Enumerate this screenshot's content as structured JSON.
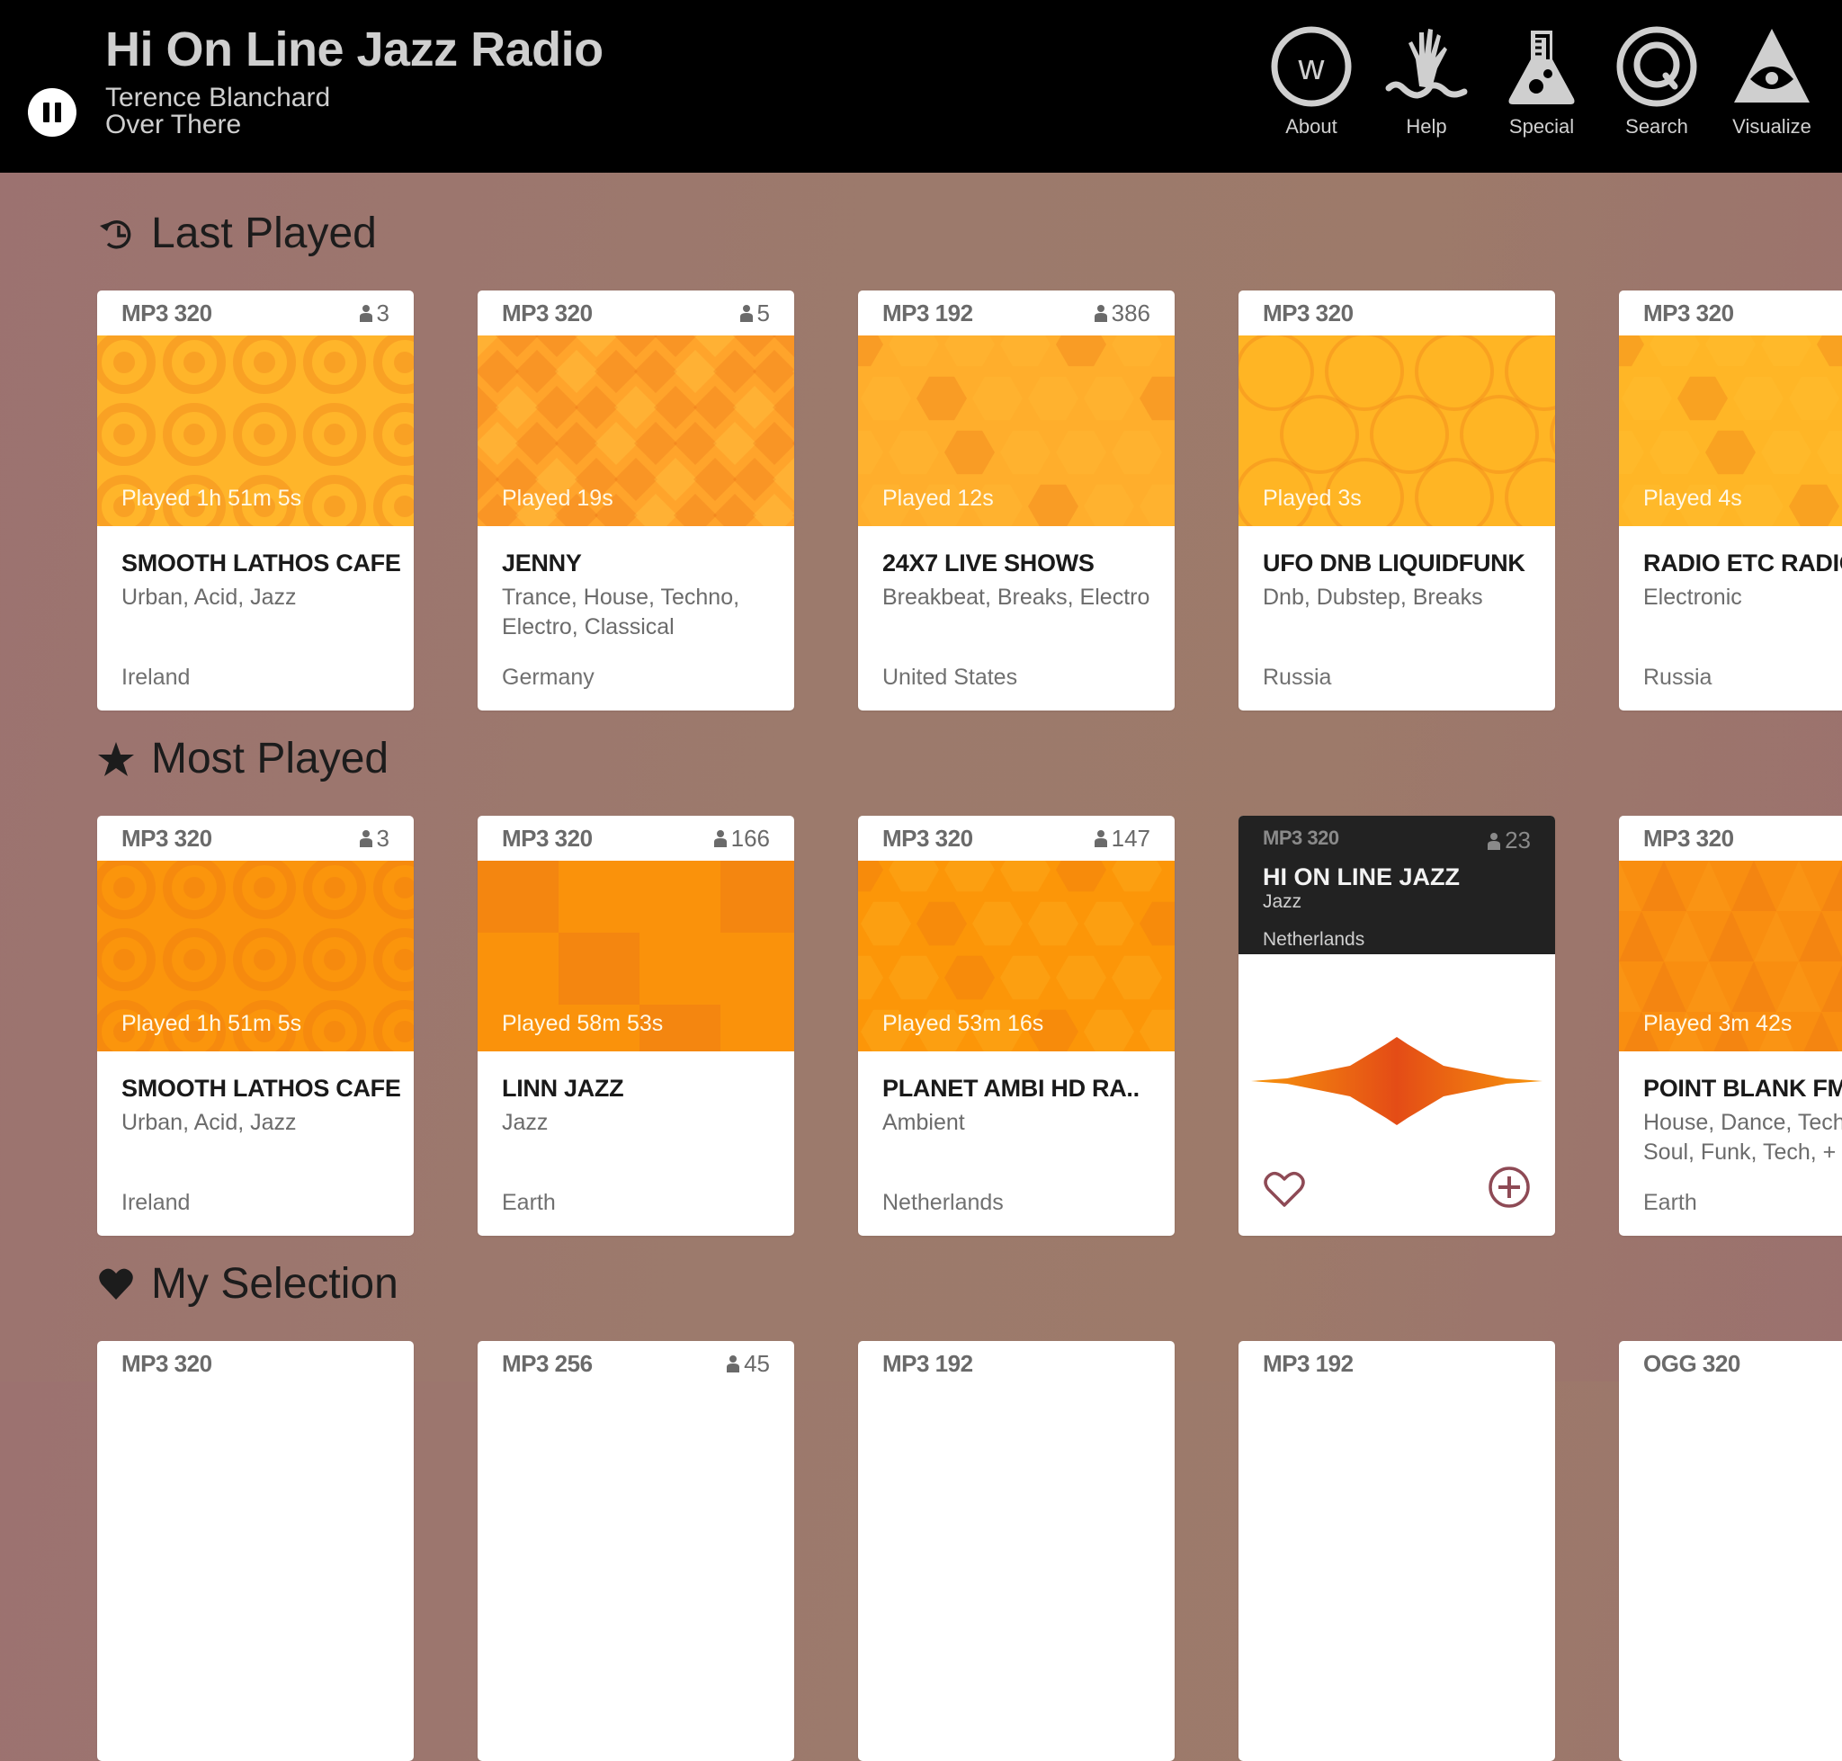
{
  "header": {
    "app_title": "Hi On Line Jazz Radio",
    "now_playing": {
      "artist": "Terence Blanchard",
      "track": "Over There"
    },
    "play_state": "playing",
    "nav": [
      {
        "label": "About",
        "icon": "about-w-icon"
      },
      {
        "label": "Help",
        "icon": "help-hand-icon"
      },
      {
        "label": "Special",
        "icon": "special-flask-icon"
      },
      {
        "label": "Search",
        "icon": "search-q-icon"
      },
      {
        "label": "Visualize",
        "icon": "visualize-eye-icon"
      }
    ]
  },
  "sections": [
    {
      "title": "Last Played",
      "icon": "history-icon",
      "cards": [
        {
          "format": "MP3 320",
          "listeners": "3",
          "played": "Played 1h 51m 5s",
          "name": "SMOOTH LATHOS CAFE",
          "genres": "Urban, Acid, Jazz",
          "country": "Ireland",
          "art": "circles",
          "color": "#ffb52a"
        },
        {
          "format": "MP3 320",
          "listeners": "5",
          "played": "Played 19s",
          "name": "JENNY",
          "genres": "Trance, House, Techno, Electro, Classical",
          "country": "Germany",
          "art": "diamonds",
          "color": "#ffa42b"
        },
        {
          "format": "MP3 192",
          "listeners": "386",
          "played": "Played 12s",
          "name": "24X7 LIVE SHOWS",
          "genres": "Breakbeat, Breaks, Electro",
          "country": "United States",
          "art": "octagons",
          "color": "#ffae2c"
        },
        {
          "format": "MP3 320",
          "listeners": "",
          "played": "Played 3s",
          "name": "UFO DNB LIQUIDFUNK",
          "genres": "Dnb, Dubstep, Breaks",
          "country": "Russia",
          "art": "rings",
          "color": "#ffb524"
        },
        {
          "format": "MP3 320",
          "listeners": "",
          "played": "Played 4s",
          "name": "RADIO ETC RADIO",
          "genres": "Electronic",
          "country": "Russia",
          "art": "hexagons",
          "color": "#ffb626"
        }
      ]
    },
    {
      "title": "Most Played",
      "icon": "star-icon",
      "cards": [
        {
          "format": "MP3 320",
          "listeners": "3",
          "played": "Played 1h 51m 5s",
          "name": "SMOOTH LATHOS CAFE",
          "genres": "Urban, Acid, Jazz",
          "country": "Ireland",
          "art": "circles",
          "color": "#fb950c"
        },
        {
          "format": "MP3 320",
          "listeners": "166",
          "played": "Played 58m 53s",
          "name": "LINN JAZZ",
          "genres": "Jazz",
          "country": "Earth",
          "art": "squares",
          "color": "#f98f0e"
        },
        {
          "format": "MP3 320",
          "listeners": "147",
          "played": "Played 53m 16s",
          "name": "PLANET AMBI HD RA..",
          "genres": "Ambient",
          "country": "Netherlands",
          "art": "hexagons",
          "color": "#fc9608"
        },
        {
          "active": true,
          "format": "MP3 320",
          "listeners": "23",
          "name": "HI ON LINE JAZZ",
          "genres": "Jazz",
          "country": "Netherlands"
        },
        {
          "format": "MP3 320",
          "listeners": "",
          "played": "Played 3m 42s",
          "name": "POINT BLANK FM",
          "genres": "House, Dance, Techno, Soul, Funk, Tech, +",
          "country": "Earth",
          "art": "triangles",
          "color": "#f98e10"
        }
      ]
    },
    {
      "title": "My Selection",
      "icon": "heart-icon",
      "cards": [
        {
          "format": "MP3 320",
          "listeners": ""
        },
        {
          "format": "MP3 256",
          "listeners": "45"
        },
        {
          "format": "MP3 192",
          "listeners": ""
        },
        {
          "format": "MP3 192",
          "listeners": ""
        },
        {
          "format": "OGG 320",
          "listeners": ""
        }
      ]
    }
  ],
  "active_card_actions": {
    "favorite": "heart-outline-icon",
    "add": "plus-circle-icon"
  },
  "colors": {
    "header_bg": "#000000",
    "accent_orange": "#e8511a",
    "icon_maroon": "#8e4a55"
  }
}
